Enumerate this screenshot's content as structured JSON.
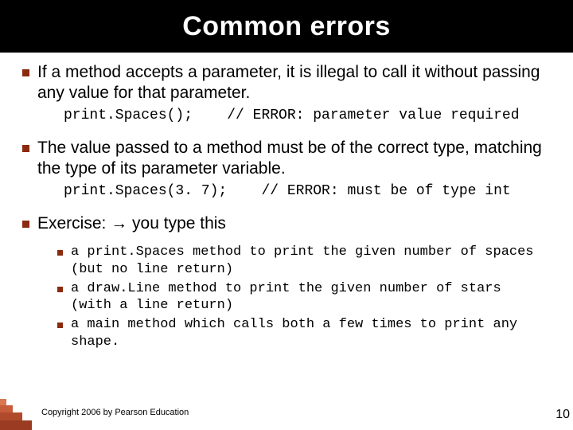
{
  "title": "Common errors",
  "bullets": [
    {
      "text": "If a method accepts a parameter, it is illegal to call it without passing any value for that parameter.",
      "code": "print.Spaces();    // ERROR: parameter value required"
    },
    {
      "text": "The value passed to a method must be of the correct type, matching the type of its parameter variable.",
      "code": "print.Spaces(3. 7);    // ERROR: must be of type int"
    }
  ],
  "exercise": {
    "label_prefix": "Exercise:  ",
    "arrow": "→",
    "label_suffix": " you type this",
    "items": [
      "a print.Spaces method to print the given number of spaces (but no line return)",
      "a draw.Line method to print the given number of stars (with a line return)",
      "a main method which calls both a few times to print any shape."
    ]
  },
  "footer": "Copyright 2006 by Pearson Education",
  "page_number": "10"
}
